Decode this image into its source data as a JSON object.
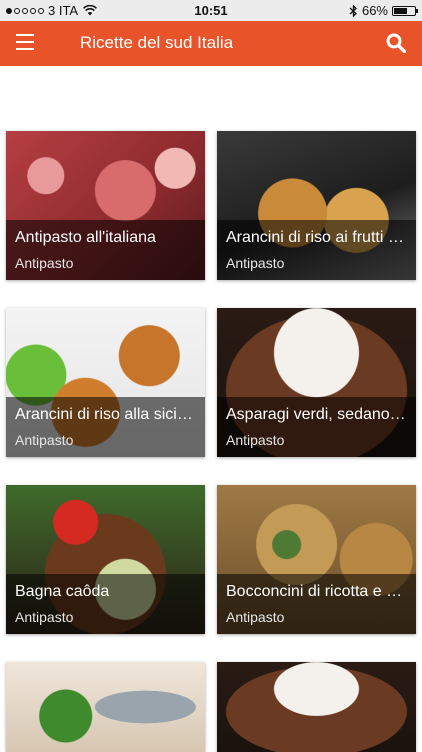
{
  "status_bar": {
    "carrier": "3 ITA",
    "time": "10:51",
    "battery_percent": "66%",
    "battery_level": 0.66,
    "signal_bars_filled": 1,
    "signal_bars_total": 5
  },
  "app_bar": {
    "title": "Ricette del sud Italia",
    "menu_icon": "hamburger-menu-icon",
    "search_icon": "search-icon",
    "color": "#e8532a"
  },
  "recipes": [
    {
      "name": "Antipasto all'italiana",
      "category": "Antipasto"
    },
    {
      "name": "Arancini di riso ai frutti di mare",
      "category": "Antipasto"
    },
    {
      "name": "Arancini di riso alla siciliana",
      "category": "Antipasto"
    },
    {
      "name": "Asparagi verdi, sedano e noci",
      "category": "Antipasto"
    },
    {
      "name": "Bagna caôda",
      "category": "Antipasto"
    },
    {
      "name": "Bocconcini di ricotta e spinaci",
      "category": "Antipasto"
    },
    {
      "name": "",
      "category": ""
    },
    {
      "name": "",
      "category": ""
    }
  ]
}
